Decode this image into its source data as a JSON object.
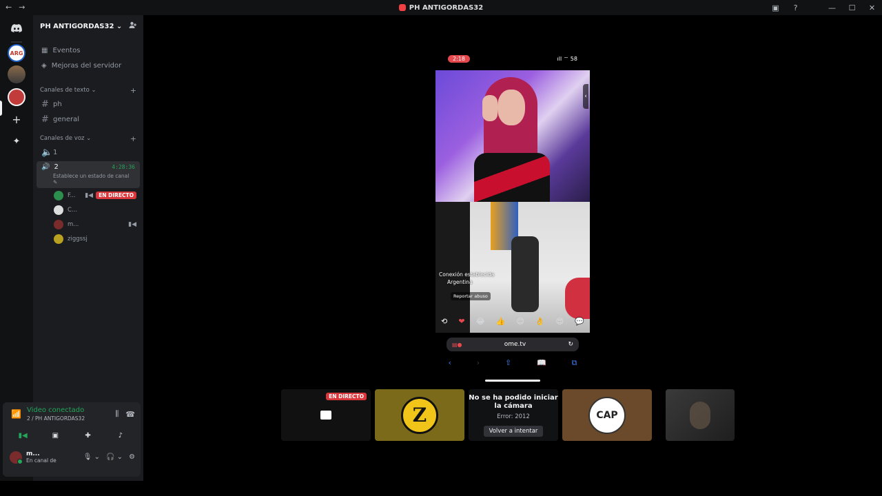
{
  "window": {
    "title": "PH ANTIGORDAS32",
    "nav_back": "←",
    "nav_fwd": "→",
    "inbox": "▣",
    "help": "?",
    "minimize": "—",
    "maximize": "☐",
    "close": "✕"
  },
  "guilds": {
    "home_icon": "discord-icon",
    "g1_label": "ARG",
    "add_icon": "+",
    "explore_icon": "✦"
  },
  "server": {
    "name": "PH ANTIGORDAS32 ⌄",
    "invite_icon": "👤",
    "events": "Eventos",
    "boosts": "Mejoras del servidor",
    "text_category": "Canales de texto ⌄",
    "voice_category": "Canales de voz ⌄",
    "text_channels": [
      "ph",
      "general"
    ],
    "voice_channels": [
      "1",
      "2"
    ],
    "active_channel_time": "4:28:36",
    "active_channel_status": "Establece un estado de canal ✎",
    "voice_users": [
      {
        "name": "F...",
        "live": "EN DIRECTO",
        "camera": true,
        "avatar_color": "#2d8f4e"
      },
      {
        "name": "C...",
        "live": "",
        "camera": false,
        "avatar_color": "#dddddd"
      },
      {
        "name": "m...",
        "live": "",
        "camera": true,
        "avatar_color": "#7a2b2b"
      },
      {
        "name": "ziggssj",
        "live": "",
        "camera": false,
        "avatar_color": "#b8a020"
      }
    ]
  },
  "voice_panel": {
    "title": "Video conectado",
    "subtitle": "2 / PH ANTIGORDAS32"
  },
  "user": {
    "name": "m...",
    "status": "En canal de"
  },
  "phone": {
    "time": "2:18",
    "status_right": "ıll ⌔ 58",
    "overlay_line1": "Conexión establecida",
    "overlay_line2": "Argentina",
    "report": "Reportar abuso",
    "emojis": [
      "⟲",
      "❤",
      "😂",
      "👍",
      "😊",
      "👌",
      "😍",
      "💬"
    ],
    "url": "ome.tv",
    "reload": "↻",
    "nav": [
      "‹",
      "›",
      "⇧",
      "📖",
      "⧉"
    ]
  },
  "tiles": {
    "t1_live": "EN DIRECTO",
    "t2_logo": "Z",
    "t3_title": "No se ha podido iniciar la cámara",
    "t3_error": "Error: 2012",
    "t3_button": "Volver a intentar",
    "t4_logo": "CAP"
  }
}
